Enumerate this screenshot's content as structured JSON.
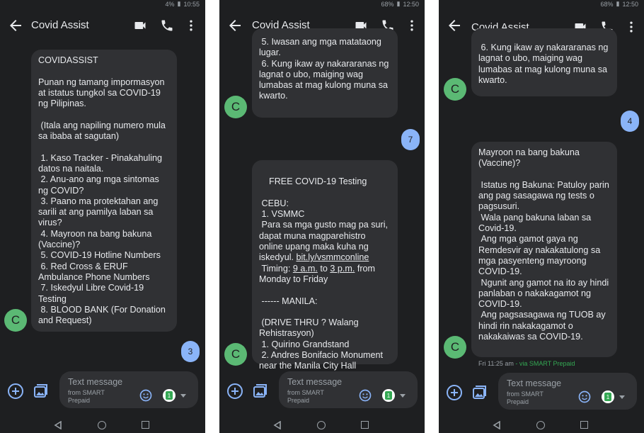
{
  "screens": [
    {
      "status": {
        "left": "",
        "battery": "4%",
        "time": "10:55"
      },
      "title": "Covid Assist",
      "bubbles": [
        {
          "text": "COVIDASSIST\n\nPunan ng tamang impormasyon at istatus tungkol sa COVID-19 ng Pilipinas.\n\n (Itala ang napiling numero mula sa ibaba at sagutan)\n\n 1. Kaso Tracker - Pinakahuling datos na naitala.\n 2. Anu-ano ang mga sintomas ng COVID?\n 3. Paano ma protektahan ang sarili at ang pamilya laban sa virus?\n 4. Mayroon na bang bakuna (Vaccine)?\n 5. COVID-19 Hotline Numbers\n 6. Red Cross & ERUF Ambulance Phone Numbers\n 7. Iskedyul Libre Covid-19 Testing\n 8. BLOOD BANK (For Donation and Request)"
        }
      ],
      "avatar_letter": "C",
      "outgoing": "3",
      "input": {
        "placeholder": "Text message",
        "sub": "from SMART Prepaid",
        "sim": "1"
      }
    },
    {
      "status": {
        "battery": "68%",
        "time": "12:50"
      },
      "title": "Covid Assist",
      "bubbles": [
        {
          "text": " 5. Iwasan ang mga matataong lugar.\n 6. Kung ikaw ay nakararanas ng lagnat o ubo, maiging wag lumabas at mag kulong muna sa kwarto."
        },
        {
          "text_parts": [
            "FREE COVID-19 Testing\n\n CEBU:\n 1. VSMMC\n Para sa mga gusto mag pa suri, dapat muna magparehistro online upang maka kuha ng iskedyul. ",
            "bit.ly/vsmmconline",
            "\n Timing: ",
            "9 a.m.",
            " to ",
            "3 p.m.",
            " from Monday to Friday\n\n ------ MANILA:\n\n (DRIVE THRU ? Walang Rehistrasyon)\n 1. Quirino Grandstand\n 2. Andres Bonifacio Monument near the Manila City Hall"
          ]
        }
      ],
      "avatar_letter": "C",
      "outgoing": "7",
      "input": {
        "placeholder": "Text message",
        "sub": "from SMART Prepaid",
        "sim": "1"
      }
    },
    {
      "status": {
        "battery": "68%",
        "time": "12:50"
      },
      "title": "Covid Assist",
      "bubbles": [
        {
          "text": " 6. Kung ikaw ay nakararanas ng lagnat o ubo, maiging wag lumabas at mag kulong muna sa kwarto."
        },
        {
          "text": "Mayroon na bang bakuna (Vaccine)?\n\n Istatus ng Bakuna: Patuloy parin ang pag sasagawa ng tests o pagsusuri.\n Wala pang bakuna laban sa Covid-19.\n Ang mga gamot gaya ng Remdesvir ay nakakatulong sa mga pasyenteng mayroong COVID-19.\n Ngunit ang gamot na ito ay hindi panlaban o nakakagamot ng COVID-19.\n Ang pagsasagawa ng TUOB ay hindi rin nakakagamot o nakakaiwas sa COVID-19."
        }
      ],
      "avatar_letter": "C",
      "outgoing": "4",
      "timestamp": "Fri 11:25 am",
      "via": " - via SMART Prepaid",
      "input": {
        "placeholder": "Text message",
        "sub": "from SMART Prepaid",
        "sim": "1"
      }
    }
  ],
  "colors": {
    "background": "#1e1f21",
    "bubble": "#303134",
    "outgoing": "#8ab4f8",
    "avatar": "#5bb974",
    "text": "#e8eaed"
  }
}
